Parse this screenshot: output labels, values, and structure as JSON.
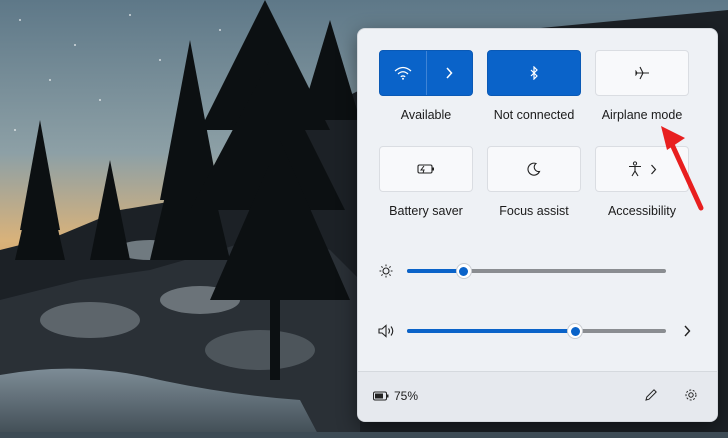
{
  "quick_settings": {
    "wifi": {
      "label": "Available",
      "icon": "wifi-icon",
      "state": "on"
    },
    "bluetooth": {
      "label": "Not connected",
      "icon": "bluetooth-icon",
      "state": "on"
    },
    "airplane": {
      "label": "Airplane mode",
      "icon": "airplane-icon",
      "state": "off"
    },
    "battery_saver": {
      "label": "Battery saver",
      "icon": "battery-saver-icon",
      "state": "off"
    },
    "focus_assist": {
      "label": "Focus assist",
      "icon": "moon-icon",
      "state": "off"
    },
    "accessibility": {
      "label": "Accessibility",
      "icon": "accessibility-icon",
      "state": "off"
    }
  },
  "brightness": {
    "icon": "brightness-icon",
    "value_fraction": 0.22
  },
  "volume": {
    "icon": "speaker-icon",
    "value_fraction": 0.65
  },
  "footer": {
    "battery_text": "75%",
    "battery_icon": "battery-icon",
    "edit_icon": "pencil-icon",
    "settings_icon": "gear-icon"
  },
  "colors": {
    "accent": "#0a63c9",
    "annotation_arrow": "#e81f1f"
  }
}
